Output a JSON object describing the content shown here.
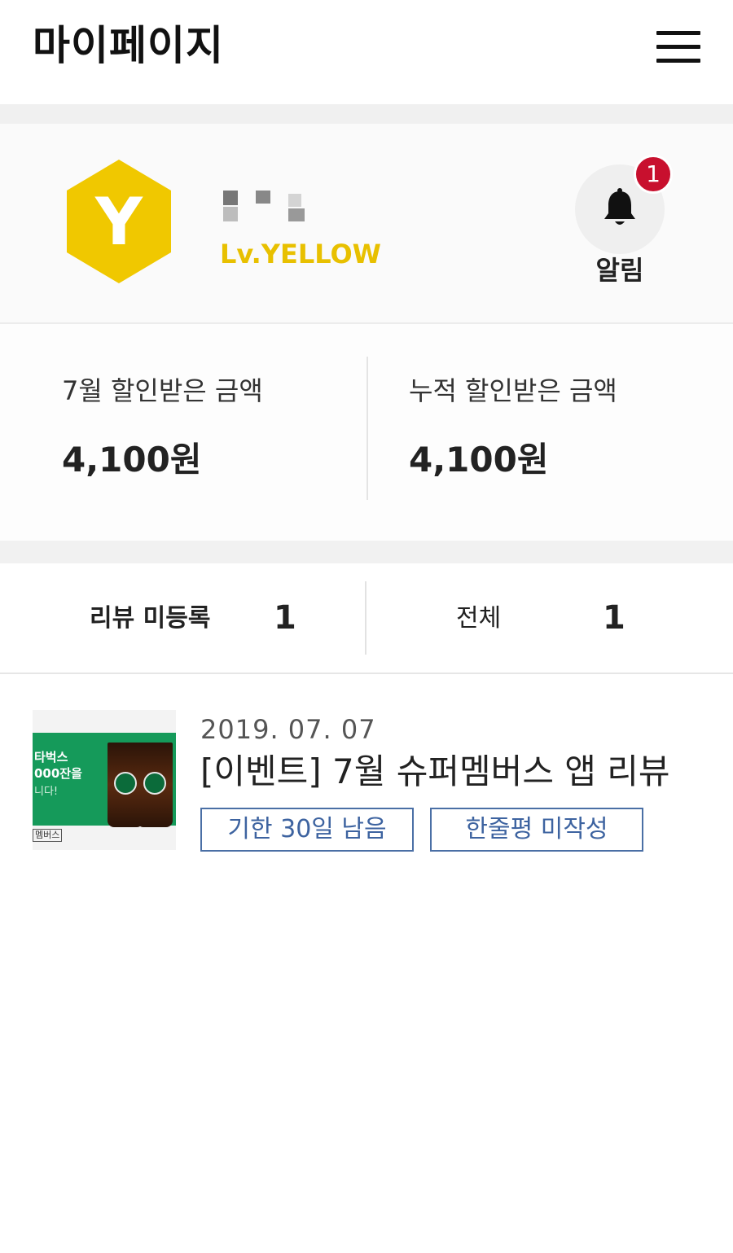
{
  "header": {
    "title": "마이페이지",
    "menu_icon": "hamburger-menu-icon"
  },
  "profile": {
    "badge_letter": "Y",
    "badge_color": "#f0c800",
    "level": "Lv.YELLOW",
    "level_color": "#e8c000",
    "notifications": {
      "icon": "bell-icon",
      "count": "1",
      "label": "알림",
      "badge_color": "#c8102e"
    }
  },
  "amounts": {
    "month": {
      "label": "7월 할인받은 금액",
      "value": "4,100원"
    },
    "total": {
      "label": "누적 할인받은 금액",
      "value": "4,100원"
    }
  },
  "tabs": [
    {
      "label": "리뷰 미등록",
      "count": "1"
    },
    {
      "label": "전체",
      "count": "1"
    }
  ],
  "review": {
    "date": "2019. 07. 07",
    "title": "[이벤트] 7월 슈퍼멤버스 앱 리뷰",
    "thumb_line1": "타벅스",
    "thumb_line2": "000잔을",
    "thumb_line3": "니다!",
    "thumb_tag": "멤버스",
    "chips": [
      "기한 30일 남음",
      "한줄평 미작성"
    ],
    "chip_color": "#3d63a0"
  }
}
